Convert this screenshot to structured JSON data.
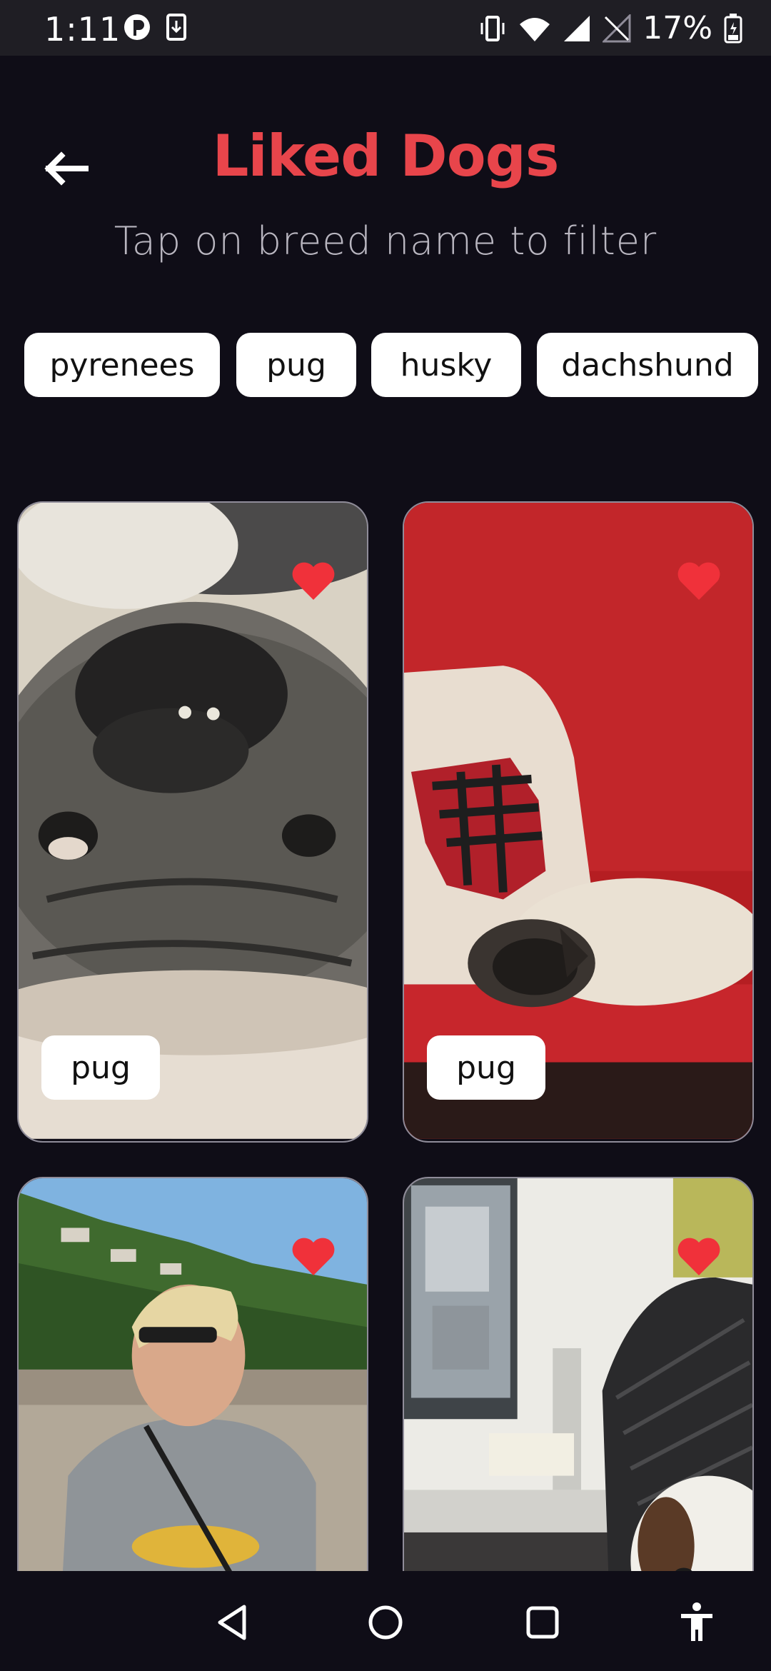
{
  "status_bar": {
    "time": "1:11",
    "battery_percent": "17%"
  },
  "header": {
    "title": "Liked Dogs",
    "subtitle": "Tap on breed name to filter"
  },
  "filters": [
    {
      "label": "pyrenees"
    },
    {
      "label": "pug"
    },
    {
      "label": "husky"
    },
    {
      "label": "dachshund"
    }
  ],
  "cards": [
    {
      "breed": "pug",
      "liked": true
    },
    {
      "breed": "pug",
      "liked": true
    },
    {
      "breed": "",
      "liked": true
    },
    {
      "breed": "",
      "liked": true
    }
  ],
  "colors": {
    "background": "#0f0d17",
    "title": "#e8454b",
    "heart": "#f0313a"
  },
  "icons": [
    "back-arrow-icon",
    "heart-icon",
    "nav-back-icon",
    "nav-home-icon",
    "nav-recents-icon",
    "accessibility-icon"
  ]
}
